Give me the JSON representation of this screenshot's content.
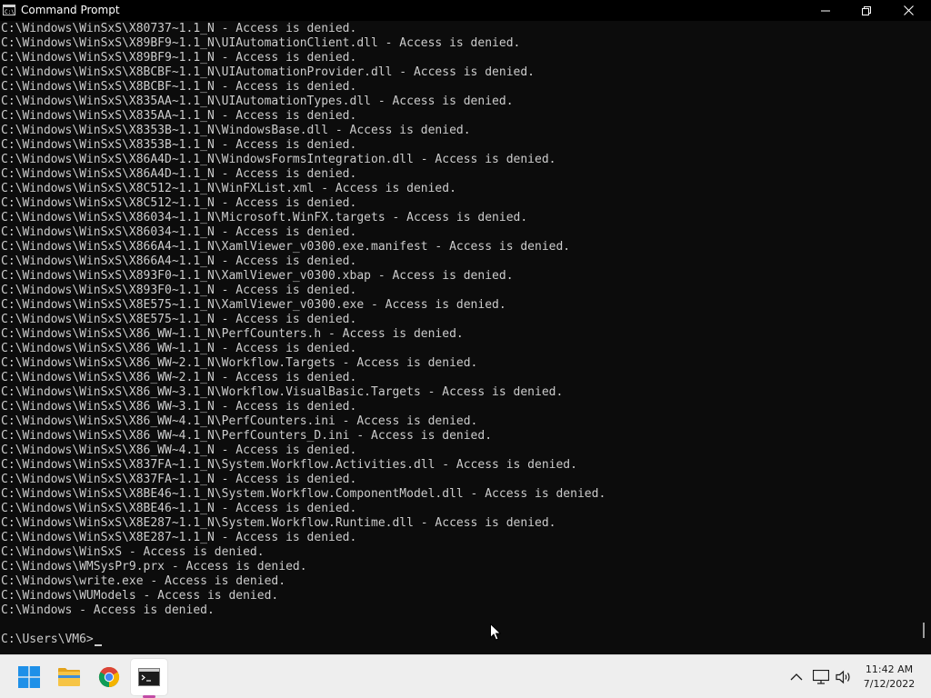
{
  "window": {
    "title": "Command Prompt",
    "controls": {
      "minimize": "minimize",
      "maximize": "maximize",
      "close": "close"
    }
  },
  "console": {
    "lines": [
      "C:\\Windows\\WinSxS\\X80737~1.1_N - Access is denied.",
      "C:\\Windows\\WinSxS\\X89BF9~1.1_N\\UIAutomationClient.dll - Access is denied.",
      "C:\\Windows\\WinSxS\\X89BF9~1.1_N - Access is denied.",
      "C:\\Windows\\WinSxS\\X8BCBF~1.1_N\\UIAutomationProvider.dll - Access is denied.",
      "C:\\Windows\\WinSxS\\X8BCBF~1.1_N - Access is denied.",
      "C:\\Windows\\WinSxS\\X835AA~1.1_N\\UIAutomationTypes.dll - Access is denied.",
      "C:\\Windows\\WinSxS\\X835AA~1.1_N - Access is denied.",
      "C:\\Windows\\WinSxS\\X8353B~1.1_N\\WindowsBase.dll - Access is denied.",
      "C:\\Windows\\WinSxS\\X8353B~1.1_N - Access is denied.",
      "C:\\Windows\\WinSxS\\X86A4D~1.1_N\\WindowsFormsIntegration.dll - Access is denied.",
      "C:\\Windows\\WinSxS\\X86A4D~1.1_N - Access is denied.",
      "C:\\Windows\\WinSxS\\X8C512~1.1_N\\WinFXList.xml - Access is denied.",
      "C:\\Windows\\WinSxS\\X8C512~1.1_N - Access is denied.",
      "C:\\Windows\\WinSxS\\X86034~1.1_N\\Microsoft.WinFX.targets - Access is denied.",
      "C:\\Windows\\WinSxS\\X86034~1.1_N - Access is denied.",
      "C:\\Windows\\WinSxS\\X866A4~1.1_N\\XamlViewer_v0300.exe.manifest - Access is denied.",
      "C:\\Windows\\WinSxS\\X866A4~1.1_N - Access is denied.",
      "C:\\Windows\\WinSxS\\X893F0~1.1_N\\XamlViewer_v0300.xbap - Access is denied.",
      "C:\\Windows\\WinSxS\\X893F0~1.1_N - Access is denied.",
      "C:\\Windows\\WinSxS\\X8E575~1.1_N\\XamlViewer_v0300.exe - Access is denied.",
      "C:\\Windows\\WinSxS\\X8E575~1.1_N - Access is denied.",
      "C:\\Windows\\WinSxS\\X86_WW~1.1_N\\PerfCounters.h - Access is denied.",
      "C:\\Windows\\WinSxS\\X86_WW~1.1_N - Access is denied.",
      "C:\\Windows\\WinSxS\\X86_WW~2.1_N\\Workflow.Targets - Access is denied.",
      "C:\\Windows\\WinSxS\\X86_WW~2.1_N - Access is denied.",
      "C:\\Windows\\WinSxS\\X86_WW~3.1_N\\Workflow.VisualBasic.Targets - Access is denied.",
      "C:\\Windows\\WinSxS\\X86_WW~3.1_N - Access is denied.",
      "C:\\Windows\\WinSxS\\X86_WW~4.1_N\\PerfCounters.ini - Access is denied.",
      "C:\\Windows\\WinSxS\\X86_WW~4.1_N\\PerfCounters_D.ini - Access is denied.",
      "C:\\Windows\\WinSxS\\X86_WW~4.1_N - Access is denied.",
      "C:\\Windows\\WinSxS\\X837FA~1.1_N\\System.Workflow.Activities.dll - Access is denied.",
      "C:\\Windows\\WinSxS\\X837FA~1.1_N - Access is denied.",
      "C:\\Windows\\WinSxS\\X8BE46~1.1_N\\System.Workflow.ComponentModel.dll - Access is denied.",
      "C:\\Windows\\WinSxS\\X8BE46~1.1_N - Access is denied.",
      "C:\\Windows\\WinSxS\\X8E287~1.1_N\\System.Workflow.Runtime.dll - Access is denied.",
      "C:\\Windows\\WinSxS\\X8E287~1.1_N - Access is denied.",
      "C:\\Windows\\WinSxS - Access is denied.",
      "C:\\Windows\\WMSysPr9.prx - Access is denied.",
      "C:\\Windows\\write.exe - Access is denied.",
      "C:\\Windows\\WUModels - Access is denied.",
      "C:\\Windows - Access is denied."
    ],
    "prompt": "C:\\Users\\VM6>"
  },
  "taskbar": {
    "apps": [
      {
        "name": "Start",
        "icon": "windows-start-icon"
      },
      {
        "name": "File Explorer",
        "icon": "folder-icon"
      },
      {
        "name": "Google Chrome",
        "icon": "chrome-icon"
      },
      {
        "name": "Command Prompt",
        "icon": "terminal-icon",
        "active": true
      }
    ],
    "tray": {
      "icons": [
        "chevron-up-icon",
        "network-icon",
        "volume-icon"
      ],
      "time": "11:42 AM",
      "date": "7/12/2022"
    }
  },
  "colors": {
    "console_bg": "#0c0c0c",
    "console_text": "#cccccc",
    "titlebar_bg": "#000000",
    "taskbar_bg": "#eeeeee",
    "active_indicator": "#c24ba6"
  }
}
